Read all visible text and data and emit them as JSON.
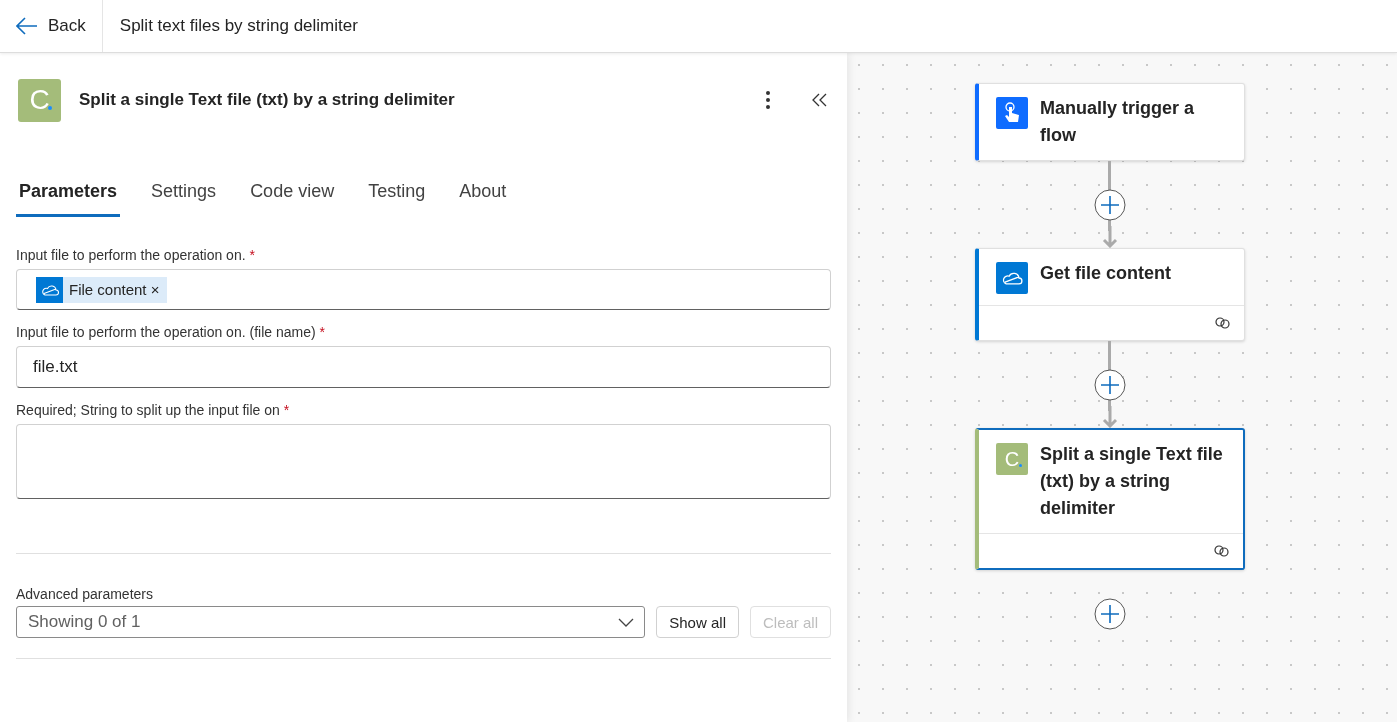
{
  "top_bar": {
    "back_label": "Back",
    "title": "Split text files by string delimiter"
  },
  "panel": {
    "title": "Split a single Text file (txt) by a string delimiter",
    "logo_letter": "C",
    "tabs": [
      {
        "label": "Parameters",
        "selected": true
      },
      {
        "label": "Settings",
        "selected": false
      },
      {
        "label": "Code view",
        "selected": false
      },
      {
        "label": "Testing",
        "selected": false
      },
      {
        "label": "About",
        "selected": false
      }
    ],
    "fields": [
      {
        "kind": "token",
        "label": "Input file to perform the operation on.",
        "required_mark": "*",
        "token": "File content",
        "token_remove": "×"
      },
      {
        "kind": "text",
        "label": "Input file to perform the operation on. (file name)",
        "required_mark": "*",
        "value": "file.txt"
      },
      {
        "kind": "textarea",
        "label": "Required; String to split up the input file on",
        "required_mark": "*"
      }
    ],
    "advanced": {
      "label": "Advanced parameters",
      "dropdown_value": "Showing 0 of 1",
      "buttons": [
        {
          "label": "Show all",
          "disabled": false
        },
        {
          "label": "Clear all",
          "disabled": true
        }
      ]
    }
  },
  "flow": {
    "nodes": [
      {
        "kind": "trigger",
        "title": "Manually trigger a flow",
        "selected": false,
        "footer": false,
        "color": "#0f6cff"
      },
      {
        "kind": "onedrive",
        "title": "Get file content",
        "selected": false,
        "footer": true,
        "color": "#0078d4"
      },
      {
        "kind": "custom",
        "title": "Split a single Text file (txt) by a string delimiter",
        "selected": true,
        "footer": true,
        "color": "#a4bc7a",
        "letter": "C"
      }
    ]
  }
}
